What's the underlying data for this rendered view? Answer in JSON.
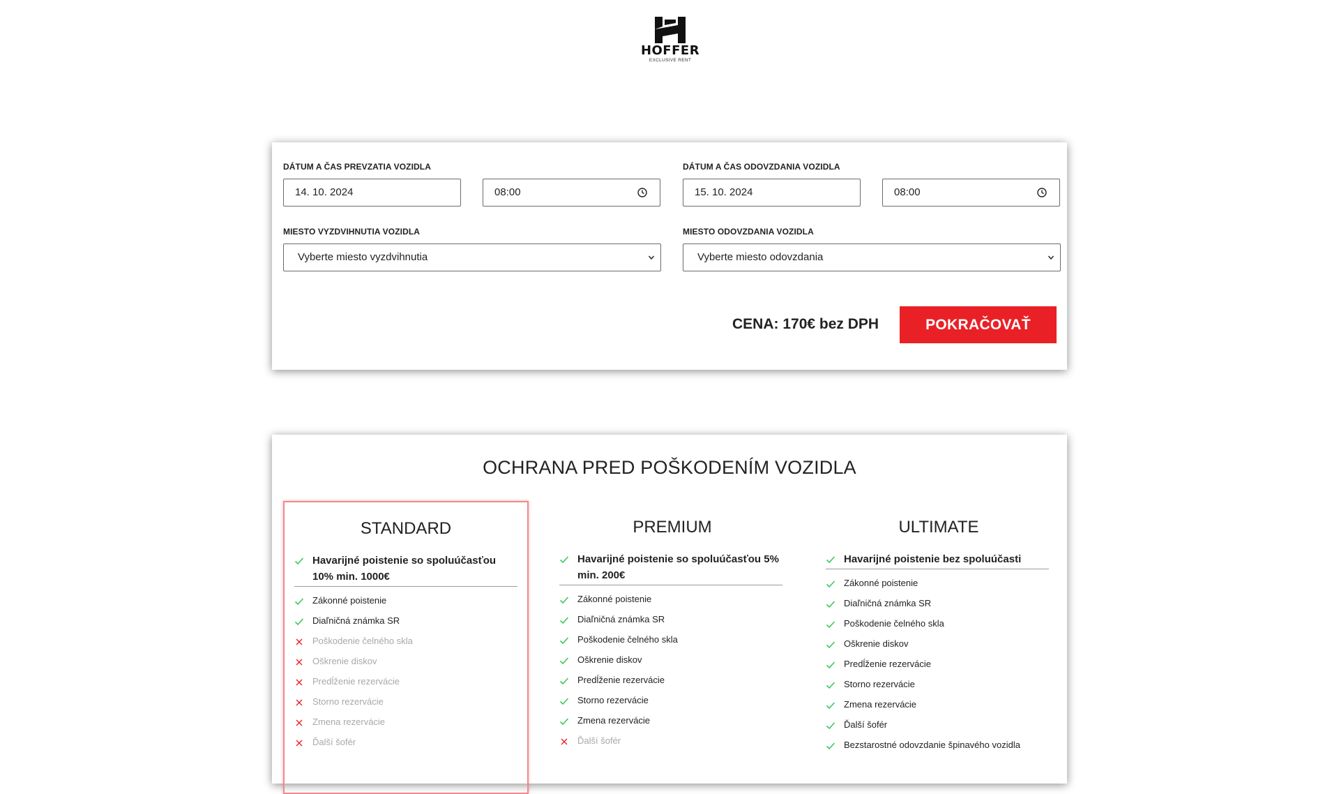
{
  "brand": {
    "name": "HOFFER",
    "tagline": "EXCLUSIVE RENT"
  },
  "booking": {
    "pickup_datetime_label": "DÁTUM A ČAS PREVZATIA VOZIDLA",
    "pickup_date": "14. 10. 2024",
    "pickup_time": "08:00",
    "return_datetime_label": "DÁTUM A ČAS ODOVZDANIA VOZIDLA",
    "return_date": "15. 10. 2024",
    "return_time": "08:00",
    "pickup_place_label": "MIESTO VYZDVIHNUTIA VOZIDLA",
    "pickup_place_value": "Vyberte miesto vyzdvihnutia",
    "return_place_label": "MIESTO ODOVZDANIA VOZIDLA",
    "return_place_value": "Vyberte miesto odovzdania",
    "price": "CENA: 170€ bez DPH",
    "continue_label": "POKRAČOVAŤ"
  },
  "protection": {
    "title": "OCHRANA PRED POŠKODENÍM VOZIDLA",
    "plans": [
      {
        "name": "STANDARD",
        "main": "Havarijné poistenie so spoluúčasťou 10% min. 1000€",
        "items": [
          {
            "label": "Zákonné poistenie",
            "included": true
          },
          {
            "label": "Diaľničná známka SR",
            "included": true
          },
          {
            "label": "Poškodenie čelného skla",
            "included": false
          },
          {
            "label": "Oškrenie diskov",
            "included": false
          },
          {
            "label": "Predĺženie rezervácie",
            "included": false
          },
          {
            "label": "Storno rezervácie",
            "included": false
          },
          {
            "label": "Zmena rezervácie",
            "included": false
          },
          {
            "label": "Ďalší šofér",
            "included": false
          }
        ]
      },
      {
        "name": "PREMIUM",
        "main": "Havarijné poistenie so spoluúčasťou 5% min. 200€",
        "items": [
          {
            "label": "Zákonné poistenie",
            "included": true
          },
          {
            "label": "Diaľničná známka SR",
            "included": true
          },
          {
            "label": "Poškodenie čelného skla",
            "included": true
          },
          {
            "label": "Oškrenie diskov",
            "included": true
          },
          {
            "label": "Predĺženie rezervácie",
            "included": true
          },
          {
            "label": "Storno rezervácie",
            "included": true
          },
          {
            "label": "Zmena rezervácie",
            "included": true
          },
          {
            "label": "Ďalší šofér",
            "included": false
          }
        ]
      },
      {
        "name": "ULTIMATE",
        "main": "Havarijné poistenie bez spoluúčasti",
        "items": [
          {
            "label": "Zákonné poistenie",
            "included": true
          },
          {
            "label": "Diaľničná známka SR",
            "included": true
          },
          {
            "label": "Poškodenie čelného skla",
            "included": true
          },
          {
            "label": "Oškrenie diskov",
            "included": true
          },
          {
            "label": "Predĺženie rezervácie",
            "included": true
          },
          {
            "label": "Storno rezervácie",
            "included": true
          },
          {
            "label": "Zmena rezervácie",
            "included": true
          },
          {
            "label": "Ďalší šofér",
            "included": true
          },
          {
            "label": "Bezstarostné odovzdanie špinavého vozidla",
            "included": true
          }
        ]
      }
    ]
  },
  "colors": {
    "accent": "#ea2027",
    "check": "#3cc85a",
    "cross": "#ea2027"
  },
  "icons": {
    "included": "check-icon",
    "excluded": "cross-icon",
    "time": "clock-icon",
    "dropdown": "chevron-down-icon"
  }
}
